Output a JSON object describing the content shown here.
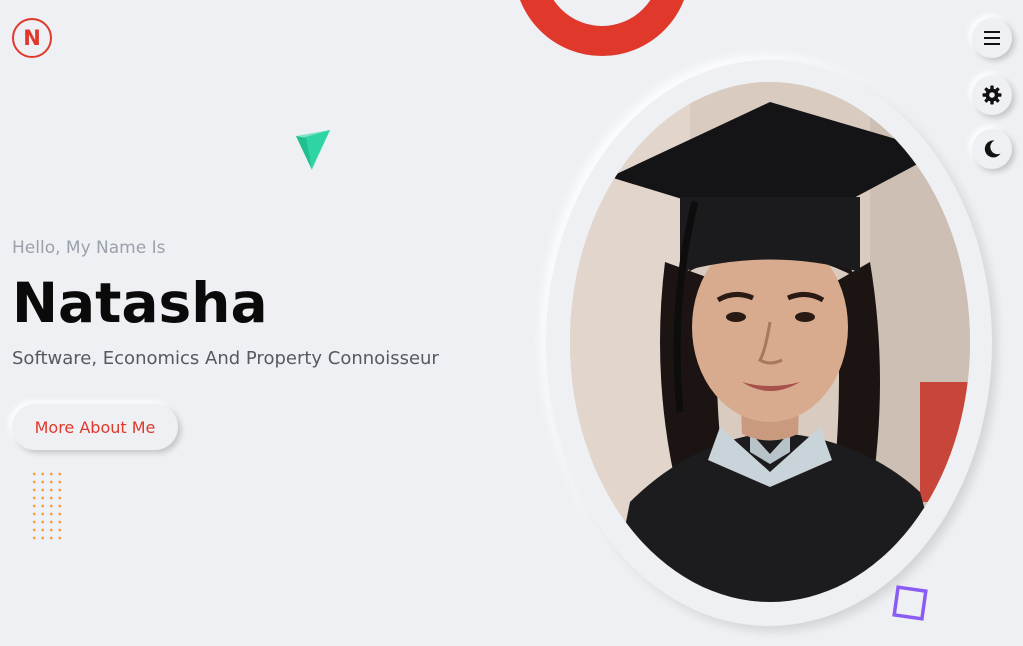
{
  "brand": {
    "logo_letter": "N"
  },
  "hero": {
    "greeting": "Hello, My Name Is",
    "name": "Natasha",
    "tagline": "Software, Economics And Property Connoisseur",
    "cta_label": "More About Me"
  },
  "icons": {
    "menu": "hamburger-menu-icon",
    "settings": "gear-icon",
    "theme": "moon-icon"
  },
  "colors": {
    "accent": "#e0392c",
    "background": "#eef0f4",
    "teal_shape": "#2fd4a4",
    "dots": "#f4a04a",
    "square": "#8a5cf5"
  }
}
